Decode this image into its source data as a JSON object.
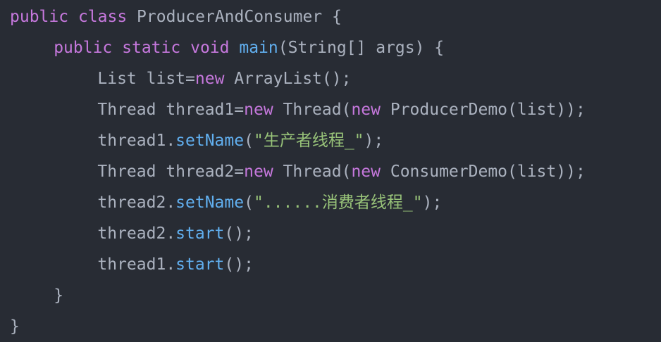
{
  "colors": {
    "background": "#282c34",
    "keyword": "#c678dd",
    "function": "#61afef",
    "string": "#98c379",
    "plain": "#abb2bf"
  },
  "code": {
    "lines": [
      {
        "indent": 0,
        "tokens": [
          {
            "t": "kw",
            "v": "public"
          },
          {
            "t": "plain",
            "v": " "
          },
          {
            "t": "kw",
            "v": "class"
          },
          {
            "t": "plain",
            "v": " ProducerAndConsumer {"
          }
        ]
      },
      {
        "indent": 4,
        "tokens": [
          {
            "t": "kw",
            "v": "public"
          },
          {
            "t": "plain",
            "v": " "
          },
          {
            "t": "kw",
            "v": "static"
          },
          {
            "t": "plain",
            "v": " "
          },
          {
            "t": "kw",
            "v": "void"
          },
          {
            "t": "plain",
            "v": " "
          },
          {
            "t": "fn",
            "v": "main"
          },
          {
            "t": "plain",
            "v": "(String[] args) {"
          }
        ]
      },
      {
        "indent": 8,
        "tokens": [
          {
            "t": "plain",
            "v": "List list"
          },
          {
            "t": "plain",
            "v": "="
          },
          {
            "t": "kw",
            "v": "new"
          },
          {
            "t": "plain",
            "v": " ArrayList();"
          }
        ]
      },
      {
        "indent": 8,
        "tokens": [
          {
            "t": "plain",
            "v": "Thread thread1"
          },
          {
            "t": "plain",
            "v": "="
          },
          {
            "t": "kw",
            "v": "new"
          },
          {
            "t": "plain",
            "v": " Thread("
          },
          {
            "t": "kw",
            "v": "new"
          },
          {
            "t": "plain",
            "v": " ProducerDemo(list));"
          }
        ]
      },
      {
        "indent": 8,
        "tokens": [
          {
            "t": "plain",
            "v": "thread1."
          },
          {
            "t": "fn",
            "v": "setName"
          },
          {
            "t": "plain",
            "v": "("
          },
          {
            "t": "str",
            "v": "\"生产者线程_\""
          },
          {
            "t": "plain",
            "v": ");"
          }
        ]
      },
      {
        "indent": 8,
        "tokens": [
          {
            "t": "plain",
            "v": "Thread thread2"
          },
          {
            "t": "plain",
            "v": "="
          },
          {
            "t": "kw",
            "v": "new"
          },
          {
            "t": "plain",
            "v": " Thread("
          },
          {
            "t": "kw",
            "v": "new"
          },
          {
            "t": "plain",
            "v": " ConsumerDemo(list));"
          }
        ]
      },
      {
        "indent": 8,
        "tokens": [
          {
            "t": "plain",
            "v": "thread2."
          },
          {
            "t": "fn",
            "v": "setName"
          },
          {
            "t": "plain",
            "v": "("
          },
          {
            "t": "str",
            "v": "\"......消费者线程_\""
          },
          {
            "t": "plain",
            "v": ");"
          }
        ]
      },
      {
        "indent": 8,
        "tokens": [
          {
            "t": "plain",
            "v": "thread2."
          },
          {
            "t": "fn",
            "v": "start"
          },
          {
            "t": "plain",
            "v": "();"
          }
        ]
      },
      {
        "indent": 8,
        "tokens": [
          {
            "t": "plain",
            "v": "thread1."
          },
          {
            "t": "fn",
            "v": "start"
          },
          {
            "t": "plain",
            "v": "();"
          }
        ]
      },
      {
        "indent": 4,
        "tokens": [
          {
            "t": "plain",
            "v": "}"
          }
        ]
      },
      {
        "indent": 0,
        "tokens": [
          {
            "t": "plain",
            "v": "}"
          }
        ]
      }
    ]
  }
}
